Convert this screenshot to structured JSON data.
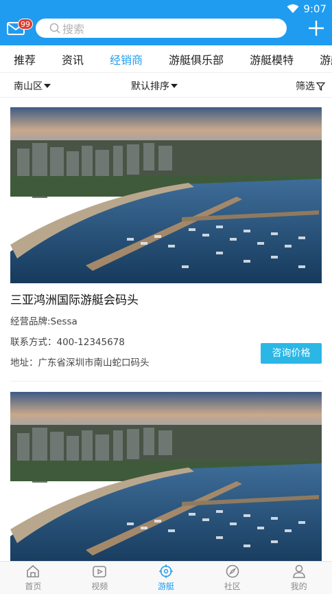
{
  "status": {
    "time": "9:07"
  },
  "header": {
    "badge_count": "99",
    "search_placeholder": "搜索"
  },
  "tabs": [
    {
      "label": "推荐",
      "active": false
    },
    {
      "label": "资讯",
      "active": false
    },
    {
      "label": "经销商",
      "active": true
    },
    {
      "label": "游艇俱乐部",
      "active": false
    },
    {
      "label": "游艇模特",
      "active": false
    },
    {
      "label": "游艇",
      "active": false
    }
  ],
  "filters": {
    "region": "南山区",
    "sort": "默认排序",
    "filter": "筛选"
  },
  "listings": [
    {
      "title": "三亚鸿洲国际游艇会码头",
      "brand": "经营品牌:Sessa",
      "phone": "联系方式：400-12345678",
      "address": "地址：广东省深圳市南山蛇口码头",
      "button": "咨询价格"
    },
    {
      "title": "",
      "brand": "",
      "phone": "",
      "address": "",
      "button": ""
    }
  ],
  "bottom_nav": [
    {
      "label": "首页",
      "icon": "home-icon",
      "active": false
    },
    {
      "label": "视频",
      "icon": "video-icon",
      "active": false
    },
    {
      "label": "游艇",
      "icon": "yacht-wheel-icon",
      "active": true
    },
    {
      "label": "社区",
      "icon": "compass-icon",
      "active": false
    },
    {
      "label": "我的",
      "icon": "user-icon",
      "active": false
    }
  ],
  "colors": {
    "brand_blue": "#1f9cf0",
    "button_cyan": "#2bb7e6",
    "badge_red": "#e23b2e"
  }
}
